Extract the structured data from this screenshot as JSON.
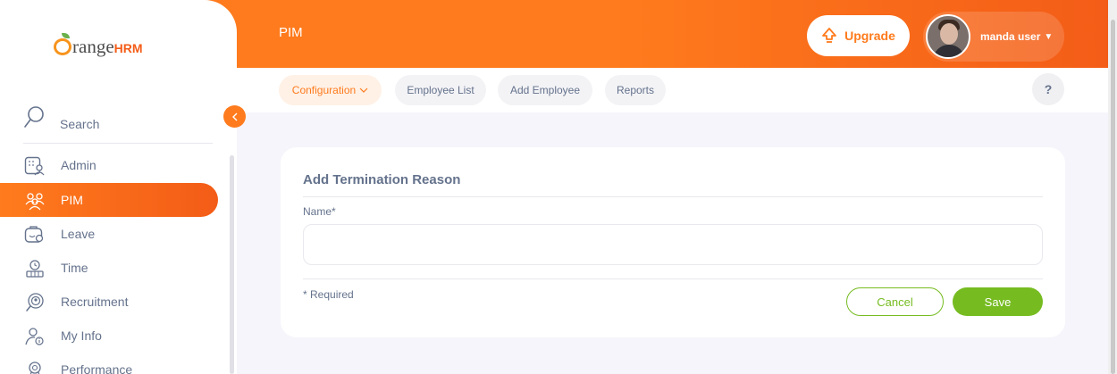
{
  "app": {
    "logo_main": "range",
    "logo_suffix": "HRM"
  },
  "topbar": {
    "module_title": "PIM",
    "upgrade_label": "Upgrade",
    "user_name": "manda user"
  },
  "sidebar": {
    "search_label": "Search",
    "items": [
      {
        "label": "Admin",
        "icon": "admin-icon",
        "active": false
      },
      {
        "label": "PIM",
        "icon": "pim-icon",
        "active": true
      },
      {
        "label": "Leave",
        "icon": "leave-icon",
        "active": false
      },
      {
        "label": "Time",
        "icon": "time-icon",
        "active": false
      },
      {
        "label": "Recruitment",
        "icon": "recruitment-icon",
        "active": false
      },
      {
        "label": "My Info",
        "icon": "my-info-icon",
        "active": false
      },
      {
        "label": "Performance",
        "icon": "performance-icon",
        "active": false
      }
    ]
  },
  "subnav": {
    "configuration": "Configuration",
    "employee_list": "Employee List",
    "add_employee": "Add Employee",
    "reports": "Reports",
    "help": "?"
  },
  "form": {
    "title": "Add Termination Reason",
    "name_label": "Name*",
    "name_value": "",
    "required_note": "* Required",
    "cancel_label": "Cancel",
    "save_label": "Save"
  },
  "colors": {
    "brand_orange": "#ff7b1d",
    "brand_green": "#76bc21",
    "text": "#64728c"
  }
}
